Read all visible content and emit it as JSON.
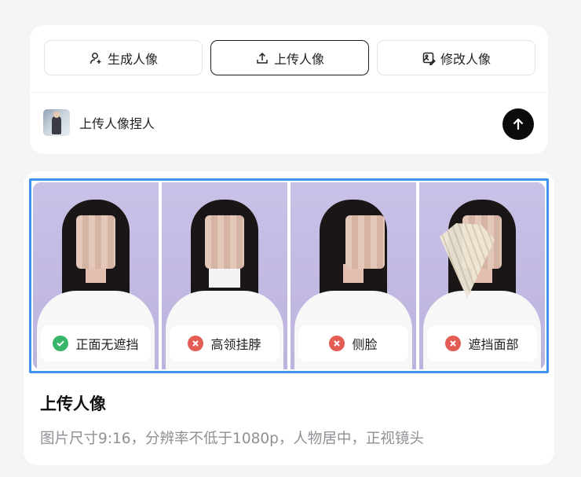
{
  "mode_tabs": [
    {
      "label": "生成人像",
      "icon": "user-add-icon",
      "active": false
    },
    {
      "label": "上传人像",
      "icon": "upload-icon",
      "active": true
    },
    {
      "label": "修改人像",
      "icon": "image-edit-icon",
      "active": false
    }
  ],
  "upload": {
    "label": "上传人像捏人",
    "send_icon": "arrow-up-icon"
  },
  "examples": [
    {
      "label": "正面无遮挡",
      "status": "ok"
    },
    {
      "label": "高领挂脖",
      "status": "bad"
    },
    {
      "label": "侧脸",
      "status": "bad"
    },
    {
      "label": "遮挡面部",
      "status": "bad"
    }
  ],
  "section": {
    "title": "上传人像",
    "desc": "图片尺寸9:16，分辨率不低于1080p，人物居中，正视镜头"
  },
  "colors": {
    "accent": "#3f93ef",
    "ok": "#39b56a",
    "bad": "#e35d55"
  }
}
